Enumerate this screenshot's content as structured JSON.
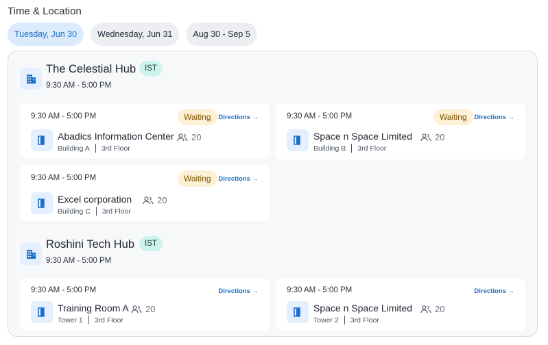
{
  "header": {
    "title": "Time & Location"
  },
  "dates": [
    {
      "label": "Tuesday, Jun 30",
      "active": true
    },
    {
      "label": "Wednesday, Jun 31",
      "active": false
    },
    {
      "label": "Aug 30 - Sep 5",
      "active": false
    }
  ],
  "hubs": [
    {
      "name": "The Celestial Hub",
      "timezone": "IST",
      "hours": "9:30 AM - 5:00 PM",
      "rooms": [
        {
          "time": "9:30 AM - 5:00 PM",
          "status": "Waiting",
          "directions": "Directions →",
          "name": "Abadics Information Center",
          "capacity": "20",
          "building": "Building A",
          "floor": "3rd Floor"
        },
        {
          "time": "9:30 AM - 5:00 PM",
          "status": "Waiting",
          "directions": "Directions →",
          "name": "Space n Space Limited",
          "capacity": "20",
          "building": "Building B",
          "floor": "3rd Floor"
        },
        {
          "time": "9:30 AM - 5:00 PM",
          "status": "Waiting",
          "directions": "Directions →",
          "name": "Excel corporation",
          "capacity": "20",
          "building": "Building C",
          "floor": "3rd Floor"
        }
      ]
    },
    {
      "name": "Roshini Tech Hub",
      "timezone": "IST",
      "hours": "9:30 AM - 5:00 PM",
      "rooms": [
        {
          "time": "9:30 AM - 5:00 PM",
          "directions": "Directions →",
          "name": "Training Room A",
          "capacity": "20",
          "building": "Tower 1",
          "floor": "3rd Floor"
        },
        {
          "time": "9:30 AM - 5:00 PM",
          "directions": "Directions →",
          "name": "Space n Space Limited",
          "capacity": "20",
          "building": "Tower 2",
          "floor": "3rd Floor"
        }
      ]
    }
  ],
  "icons": {
    "hub": "building-icon",
    "room": "door-icon",
    "capacity": "people-icon"
  },
  "colors": {
    "accent": "#1a6fc7",
    "waiting_bg": "#fdf0d5",
    "badge_bg": "#cdf4ea"
  }
}
